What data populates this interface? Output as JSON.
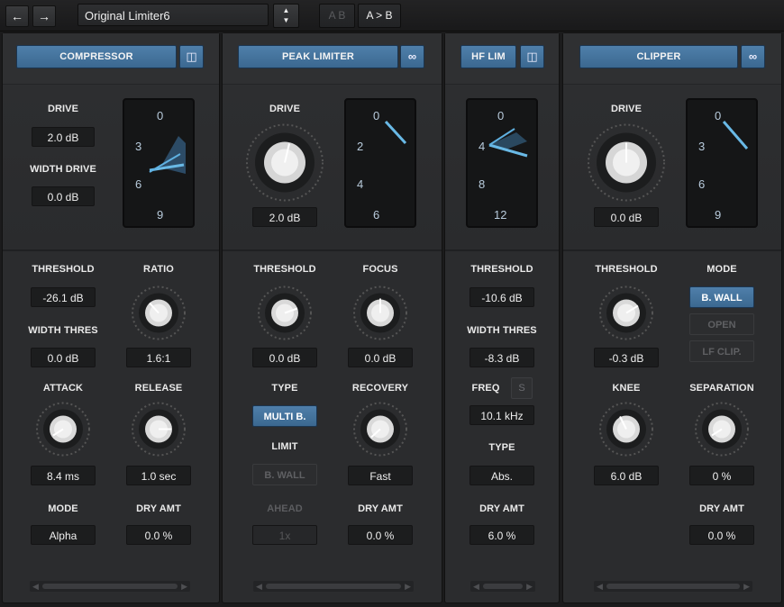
{
  "toolbar": {
    "back_icon": "arrow-left-icon",
    "forward_icon": "arrow-right-icon",
    "preset_name": "Original Limiter6",
    "ab_label": "A B",
    "a_to_b_label": "A > B"
  },
  "compressor": {
    "title": "COMPRESSOR",
    "drive_label": "DRIVE",
    "drive_value": "2.0 dB",
    "width_drive_label": "WIDTH DRIVE",
    "width_drive_value": "0.0 dB",
    "meter_ticks": [
      "0",
      "3",
      "6",
      "9"
    ],
    "threshold_label": "THRESHOLD",
    "threshold_value": "-26.1 dB",
    "ratio_label": "RATIO",
    "ratio_value": "1.6:1",
    "width_thres_label": "WIDTH THRES",
    "width_thres_value": "0.0 dB",
    "attack_label": "ATTACK",
    "attack_value": "8.4 ms",
    "release_label": "RELEASE",
    "release_value": "1.0 sec",
    "mode_label": "MODE",
    "mode_value": "Alpha",
    "dry_amt_label": "DRY AMT",
    "dry_amt_value": "0.0 %"
  },
  "peak_limiter": {
    "title": "PEAK LIMITER",
    "drive_label": "DRIVE",
    "drive_value": "2.0 dB",
    "meter_ticks": [
      "0",
      "2",
      "4",
      "6"
    ],
    "threshold_label": "THRESHOLD",
    "threshold_value": "0.0 dB",
    "focus_label": "FOCUS",
    "focus_value": "0.0 dB",
    "type_label": "TYPE",
    "type_value": "MULTI B.",
    "recovery_label": "RECOVERY",
    "recovery_value": "Fast",
    "limit_label": "LIMIT",
    "limit_value": "B. WALL",
    "ahead_label": "AHEAD",
    "ahead_value": "1x",
    "dry_amt_label": "DRY AMT",
    "dry_amt_value": "0.0 %"
  },
  "hf_lim": {
    "title": "HF LIM",
    "meter_ticks": [
      "0",
      "4",
      "8",
      "12"
    ],
    "threshold_label": "THRESHOLD",
    "threshold_value": "-10.6 dB",
    "width_thres_label": "WIDTH THRES",
    "width_thres_value": "-8.3 dB",
    "freq_label": "FREQ",
    "freq_s_label": "S",
    "freq_value": "10.1 kHz",
    "type_label": "TYPE",
    "type_value": "Abs.",
    "dry_amt_label": "DRY AMT",
    "dry_amt_value": "6.0 %"
  },
  "clipper": {
    "title": "CLIPPER",
    "drive_label": "DRIVE",
    "drive_value": "0.0 dB",
    "meter_ticks": [
      "0",
      "3",
      "6",
      "9"
    ],
    "threshold_label": "THRESHOLD",
    "threshold_value": "-0.3 dB",
    "mode_label": "MODE",
    "mode_options": [
      "B. WALL",
      "OPEN",
      "LF CLIP."
    ],
    "knee_label": "KNEE",
    "knee_value": "6.0 dB",
    "separation_label": "SEPARATION",
    "separation_value": "0 %",
    "dry_amt_label": "DRY AMT",
    "dry_amt_value": "0.0 %"
  },
  "colors": {
    "accent_blue": "#4a7aa5",
    "meter_needle": "#5fb0e0",
    "panel": "#2b2c2e"
  }
}
